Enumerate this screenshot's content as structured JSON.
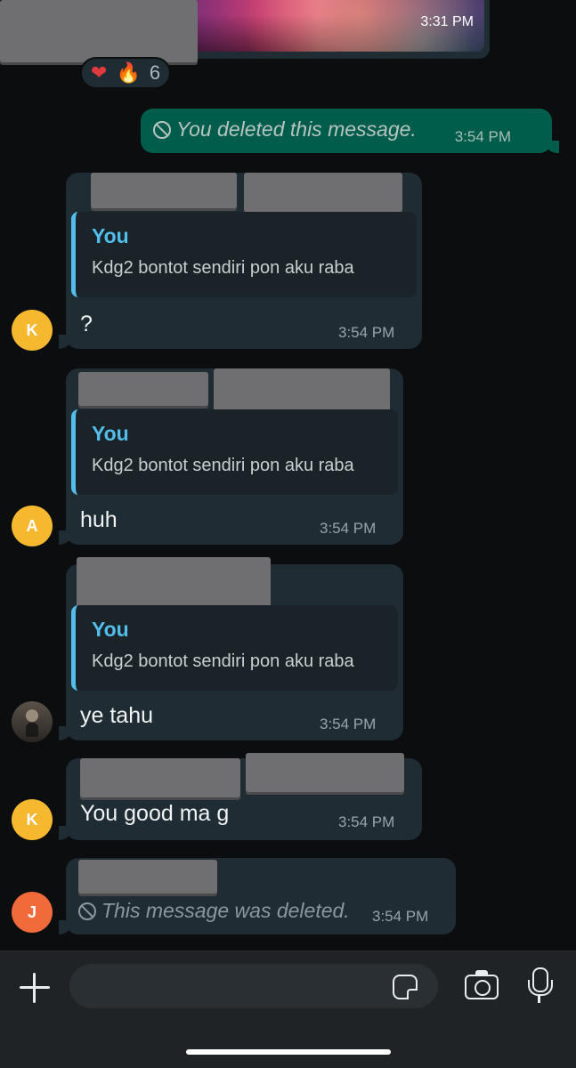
{
  "top_message": {
    "time": "3:31 PM",
    "reactions": {
      "heart": "❤",
      "fire": "🔥",
      "count": "6"
    }
  },
  "outgoing_deleted": {
    "text": "You deleted this message.",
    "time": "3:54 PM"
  },
  "messages": [
    {
      "avatar": "K",
      "avatar_color": "#f5b82e",
      "quote_name": "You",
      "quote_text": "Kdg2 bontot sendiri pon aku raba",
      "text": "?",
      "time": "3:54 PM"
    },
    {
      "avatar": "A",
      "avatar_color": "#f5b82e",
      "quote_name": "You",
      "quote_text": "Kdg2 bontot sendiri pon aku raba",
      "text": "huh",
      "time": "3:54 PM"
    },
    {
      "avatar": "",
      "quote_name": "You",
      "quote_text": "Kdg2 bontot sendiri pon aku raba",
      "text": "ye tahu",
      "time": "3:54 PM"
    },
    {
      "avatar": "K",
      "avatar_color": "#f5b82e",
      "text": "You good ma g",
      "time": "3:54 PM"
    },
    {
      "avatar": "J",
      "avatar_color": "#f06a3a",
      "deleted_text": "This message was deleted.",
      "time": "3:54 PM"
    }
  ],
  "colors": {
    "outgoing_bubble": "#005c4b",
    "incoming_bubble": "#202c33",
    "quote_accent": "#53bdeb",
    "background": "#0b0d0e"
  },
  "input_bar": {
    "placeholder": "",
    "icons": [
      "plus-icon",
      "sticker-icon",
      "camera-icon",
      "mic-icon"
    ]
  }
}
